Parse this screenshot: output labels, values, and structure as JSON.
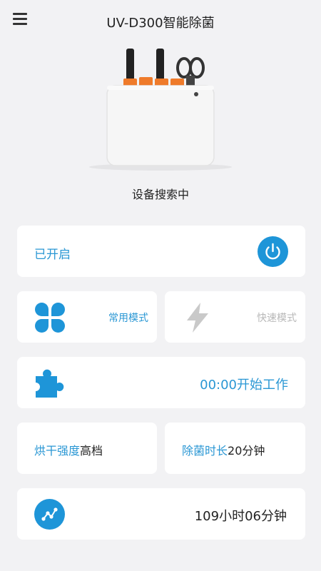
{
  "header": {
    "title": "UV-D300智能除菌"
  },
  "device": {
    "status": "设备搜索中"
  },
  "power": {
    "label": "已开启"
  },
  "modes": {
    "normal_label": "常用模式",
    "fast_label": "快速模式"
  },
  "timer": {
    "text": "00:00开始工作"
  },
  "drying": {
    "label": "烘干强度",
    "value": "高档"
  },
  "sterilization": {
    "label": "除菌时长",
    "value": "20分钟"
  },
  "total": {
    "text": "109小时06分钟"
  },
  "colors": {
    "accent": "#1e95d8",
    "text_blue": "#2a97d4",
    "inactive": "#b8b8b8",
    "background": "#f2f2f4"
  }
}
